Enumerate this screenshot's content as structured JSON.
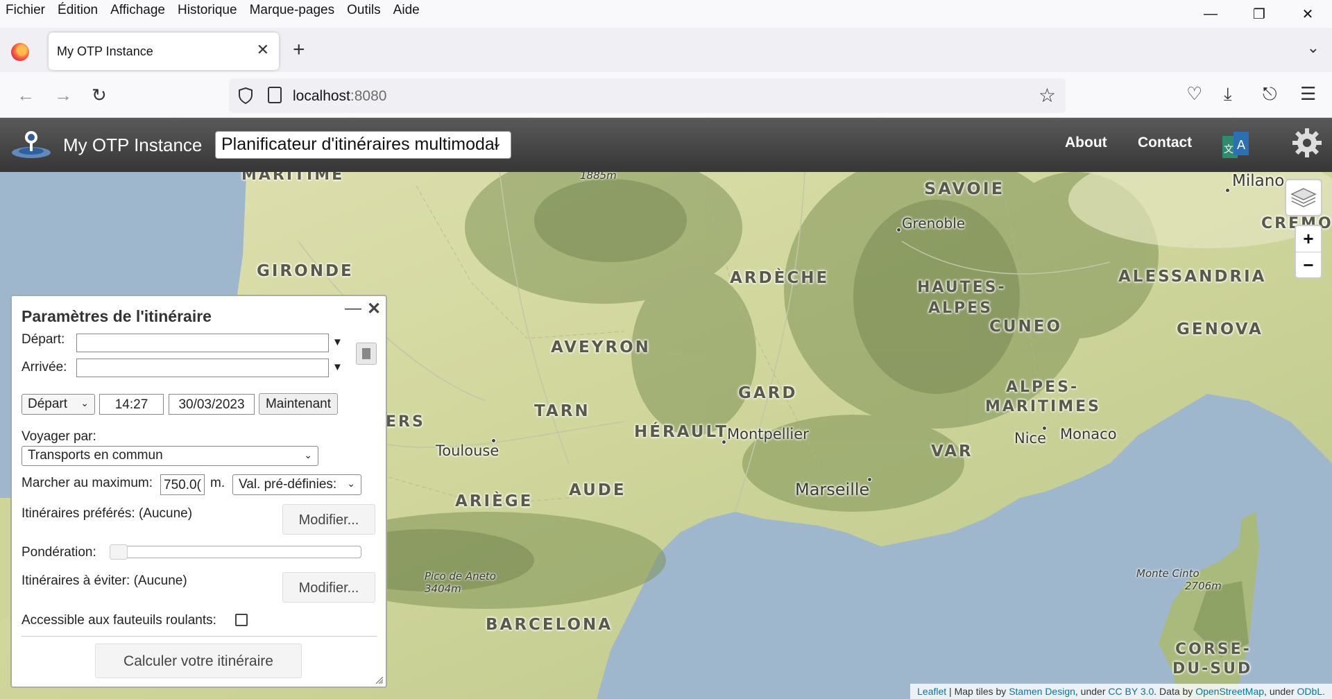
{
  "browser": {
    "menu": [
      "Fichier",
      "Édition",
      "Affichage",
      "Historique",
      "Marque-pages",
      "Outils",
      "Aide"
    ],
    "tab_title": "My OTP Instance",
    "url_host": "localhost",
    "url_port": ":8080"
  },
  "app": {
    "title": "My OTP Instance",
    "mode": "Planificateur d'itinéraires multimodal",
    "nav": {
      "about": "About",
      "contact": "Contact"
    }
  },
  "planner": {
    "title": "Paramètres de l'itinéraire",
    "from_label": "Départ:",
    "from_value": "",
    "to_label": "Arrivée:",
    "to_value": "",
    "time_mode": "Départ",
    "time": "14:27",
    "date": "30/03/2023",
    "now_button": "Maintenant",
    "travel_label": "Voyager par:",
    "travel_mode": "Transports en commun",
    "walk_label": "Marcher au maximum:",
    "walk_value": "750.0(",
    "walk_unit": "m.",
    "presets": "Val. pré-définies:",
    "preferred_label": "Itinéraires préférés: (Aucune)",
    "modify_label": "Modifier...",
    "weight_label": "Pondération:",
    "weight_value": 0,
    "avoid_label": "Itinéraires à éviter: (Aucune)",
    "wheelchair_label": "Accessible aux fauteuils roulants:",
    "wheelchair_checked": false,
    "submit": "Calculer votre itinéraire"
  },
  "map": {
    "regions": [
      {
        "name": "MARITIME"
      },
      {
        "name": "SAVOIE"
      },
      {
        "name": "GIRONDE"
      },
      {
        "name": "ARDÈCHE"
      },
      {
        "name": "HAUTES-"
      },
      {
        "name": "ALPES"
      },
      {
        "name": "ALESSANDRIA"
      },
      {
        "name": "CREMO"
      },
      {
        "name": "AVEYRON"
      },
      {
        "name": "CUNEO"
      },
      {
        "name": "GENOVA"
      },
      {
        "name": "GARD"
      },
      {
        "name": "ALPES-"
      },
      {
        "name": "MARITIMES"
      },
      {
        "name": "TARN"
      },
      {
        "name": "ERS"
      },
      {
        "name": "HÉRAULT"
      },
      {
        "name": "VAR"
      },
      {
        "name": "AUDE"
      },
      {
        "name": "ARIÈGE"
      },
      {
        "name": "BARCELONA"
      },
      {
        "name": "CORSE-"
      },
      {
        "name": "DU-SUD"
      }
    ],
    "cities": [
      {
        "name": "Milano"
      },
      {
        "name": "Grenoble"
      },
      {
        "name": "Toulouse"
      },
      {
        "name": "Montpellier"
      },
      {
        "name": "Nice"
      },
      {
        "name": "Monaco"
      },
      {
        "name": "Marseille"
      }
    ],
    "peaks": [
      {
        "name": "1885m"
      },
      {
        "name": "Pico de Aneto",
        "alt": "3404m"
      },
      {
        "name": "Monte Cinto",
        "alt": "2706m"
      }
    ],
    "zoom_in": "+",
    "zoom_out": "−",
    "attribution": {
      "leaflet": "Leaflet",
      "t1": " | Map tiles by ",
      "stamen": "Stamen Design",
      "t2": ", under ",
      "ccby": "CC BY 3.0",
      "t3": ". Data by ",
      "osm": "OpenStreetMap",
      "t4": ", under ",
      "odbl": "ODbL."
    }
  },
  "colors": {
    "header": "#444444",
    "sea": "#9fb7cd",
    "land": "#d8d9a4",
    "link": "#0078a8"
  }
}
